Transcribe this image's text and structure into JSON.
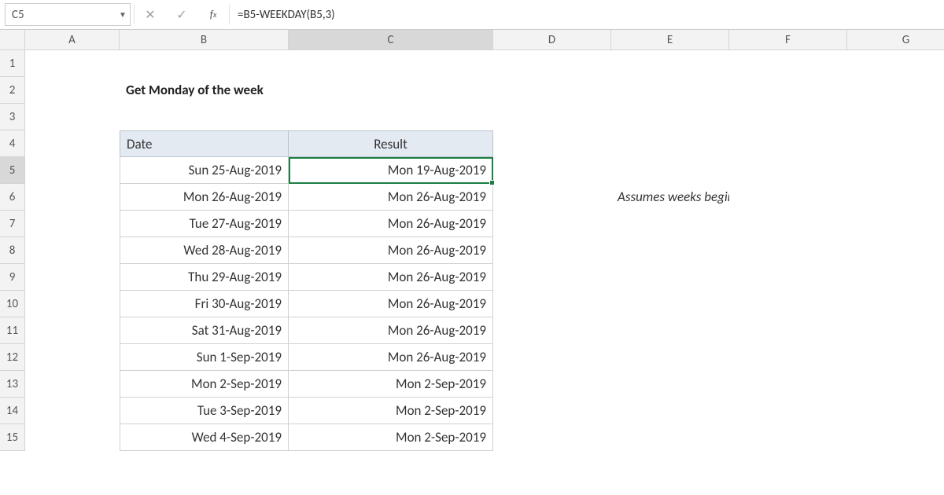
{
  "namebox": "C5",
  "formula": "=B5-WEEKDAY(B5,3)",
  "columns": [
    "A",
    "B",
    "C",
    "D",
    "E",
    "F",
    "G"
  ],
  "rows": [
    "1",
    "2",
    "3",
    "4",
    "5",
    "6",
    "7",
    "8",
    "9",
    "10",
    "11",
    "12",
    "13",
    "14",
    "15"
  ],
  "title": "Get Monday of the week",
  "headers": {
    "date": "Date",
    "result": "Result"
  },
  "table": [
    {
      "date": "Sun 25-Aug-2019",
      "result": "Mon 19-Aug-2019"
    },
    {
      "date": "Mon 26-Aug-2019",
      "result": "Mon 26-Aug-2019"
    },
    {
      "date": "Tue 27-Aug-2019",
      "result": "Mon 26-Aug-2019"
    },
    {
      "date": "Wed 28-Aug-2019",
      "result": "Mon 26-Aug-2019"
    },
    {
      "date": "Thu 29-Aug-2019",
      "result": "Mon 26-Aug-2019"
    },
    {
      "date": "Fri 30-Aug-2019",
      "result": "Mon 26-Aug-2019"
    },
    {
      "date": "Sat 31-Aug-2019",
      "result": "Mon 26-Aug-2019"
    },
    {
      "date": "Sun 1-Sep-2019",
      "result": "Mon 26-Aug-2019"
    },
    {
      "date": "Mon 2-Sep-2019",
      "result": "Mon 2-Sep-2019"
    },
    {
      "date": "Tue 3-Sep-2019",
      "result": "Mon 2-Sep-2019"
    },
    {
      "date": "Wed 4-Sep-2019",
      "result": "Mon 2-Sep-2019"
    }
  ],
  "note": "Assumes weeks begin on Monday",
  "icons": {
    "cancel": "✕",
    "enter": "✓",
    "fx": "fx",
    "dropdown": "▼"
  },
  "selection": {
    "cell": "C5"
  }
}
